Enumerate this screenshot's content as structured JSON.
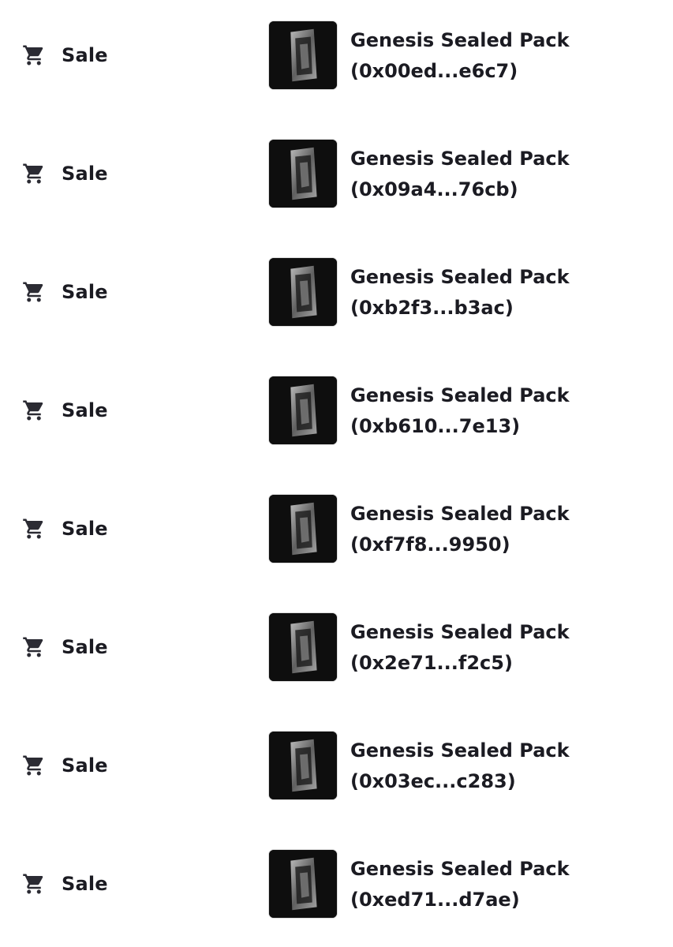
{
  "activity": {
    "rows": [
      {
        "event": {
          "icon": "cart-icon",
          "label": "Sale"
        },
        "item": {
          "name": "Genesis Sealed Pack",
          "id": "(0x00ed...e6c7)"
        }
      },
      {
        "event": {
          "icon": "cart-icon",
          "label": "Sale"
        },
        "item": {
          "name": "Genesis Sealed Pack",
          "id": "(0x09a4...76cb)"
        }
      },
      {
        "event": {
          "icon": "cart-icon",
          "label": "Sale"
        },
        "item": {
          "name": "Genesis Sealed Pack",
          "id": "(0xb2f3...b3ac)"
        }
      },
      {
        "event": {
          "icon": "cart-icon",
          "label": "Sale"
        },
        "item": {
          "name": "Genesis Sealed Pack",
          "id": "(0xb610...7e13)"
        }
      },
      {
        "event": {
          "icon": "cart-icon",
          "label": "Sale"
        },
        "item": {
          "name": "Genesis Sealed Pack",
          "id": "(0xf7f8...9950)"
        }
      },
      {
        "event": {
          "icon": "cart-icon",
          "label": "Sale"
        },
        "item": {
          "name": "Genesis Sealed Pack",
          "id": "(0x2e71...f2c5)"
        }
      },
      {
        "event": {
          "icon": "cart-icon",
          "label": "Sale"
        },
        "item": {
          "name": "Genesis Sealed Pack",
          "id": "(0x03ec...c283)"
        }
      },
      {
        "event": {
          "icon": "cart-icon",
          "label": "Sale"
        },
        "item": {
          "name": "Genesis Sealed Pack",
          "id": "(0xed71...d7ae)"
        }
      }
    ]
  },
  "colors": {
    "text": "#1b1b22",
    "thumbnail_background": "#0e0e0e",
    "page_background": "#ffffff"
  }
}
